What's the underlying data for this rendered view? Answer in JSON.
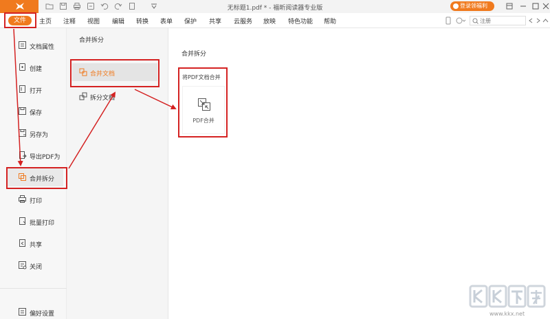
{
  "window": {
    "title": "无标题1.pdf * - 福昕阅读器专业版",
    "login_button": "登录领福利"
  },
  "menubar": {
    "file": "文件",
    "items": [
      "主页",
      "注释",
      "视图",
      "编辑",
      "转换",
      "表单",
      "保护",
      "共享",
      "云服务",
      "放映",
      "特色功能",
      "帮助"
    ],
    "search_placeholder": "注册"
  },
  "sidebar": {
    "items": [
      {
        "label": "文档属性",
        "icon": "document-properties-icon"
      },
      {
        "label": "创建",
        "icon": "create-icon"
      },
      {
        "label": "打开",
        "icon": "open-icon"
      },
      {
        "label": "保存",
        "icon": "save-icon"
      },
      {
        "label": "另存为",
        "icon": "save-as-icon"
      },
      {
        "label": "导出PDF为",
        "icon": "export-icon"
      },
      {
        "label": "合并拆分",
        "icon": "merge-split-icon",
        "active": true
      },
      {
        "label": "打印",
        "icon": "print-icon"
      },
      {
        "label": "批量打印",
        "icon": "batch-print-icon"
      },
      {
        "label": "共享",
        "icon": "share-icon"
      },
      {
        "label": "关闭",
        "icon": "close-doc-icon"
      }
    ],
    "preferences": "偏好设置"
  },
  "middle": {
    "title": "合并拆分",
    "items": [
      {
        "label": "合并文档",
        "active": true
      },
      {
        "label": "拆分文档"
      }
    ]
  },
  "main": {
    "title": "合并拆分",
    "section_label": "将PDF文档合并",
    "card_label": "PDF合并"
  },
  "watermark": {
    "text": "www.kkx.net"
  },
  "colors": {
    "accent": "#f07a1e",
    "annotation": "#d42121"
  }
}
